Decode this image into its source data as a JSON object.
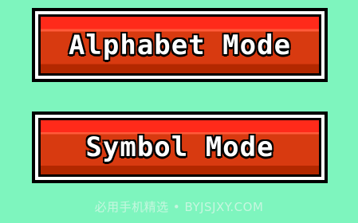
{
  "menu": {
    "alphabet_mode": "Alphabet Mode",
    "symbol_mode": "Symbol Mode"
  },
  "watermark": "必用手机精选 • BYJSJXY.COM",
  "colors": {
    "background": "#7ef5be",
    "button_red_light": "#ff2a1a",
    "button_red_dark": "#d83a10",
    "button_border": "#000000",
    "button_outline": "#ffffff",
    "label": "#ffffff"
  }
}
